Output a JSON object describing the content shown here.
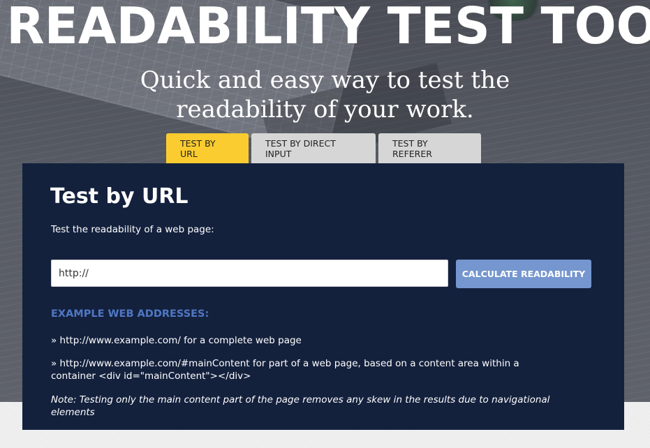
{
  "header": {
    "title": "READABILITY TEST TOOL",
    "subtitle_line1": "Quick and easy way to test the",
    "subtitle_line2": "readability of your work."
  },
  "tabs": [
    {
      "label": "TEST BY URL",
      "active": true
    },
    {
      "label": "TEST BY DIRECT INPUT",
      "active": false
    },
    {
      "label": "TEST BY REFERER",
      "active": false
    }
  ],
  "panel": {
    "title": "Test by URL",
    "description": "Test the readability of a web page:",
    "url_input_value": "http://",
    "calculate_button": "CALCULATE READABILITY",
    "examples_heading": "EXAMPLE WEB ADDRESSES:",
    "examples": [
      "» http://www.example.com/ for a complete web page",
      "» http://www.example.com/#mainContent for part of a web page, based on a content area within a container <div id=\"mainContent\"></div>"
    ],
    "note": "Note: Testing only the main content part of the page removes any skew in the results due to navigational elements"
  },
  "colors": {
    "panel_bg": "#14213d",
    "active_tab": "#fbcc2f",
    "inactive_tab": "#d6d6d6",
    "button_bg": "#7596cf",
    "examples_heading": "#5077c4"
  }
}
